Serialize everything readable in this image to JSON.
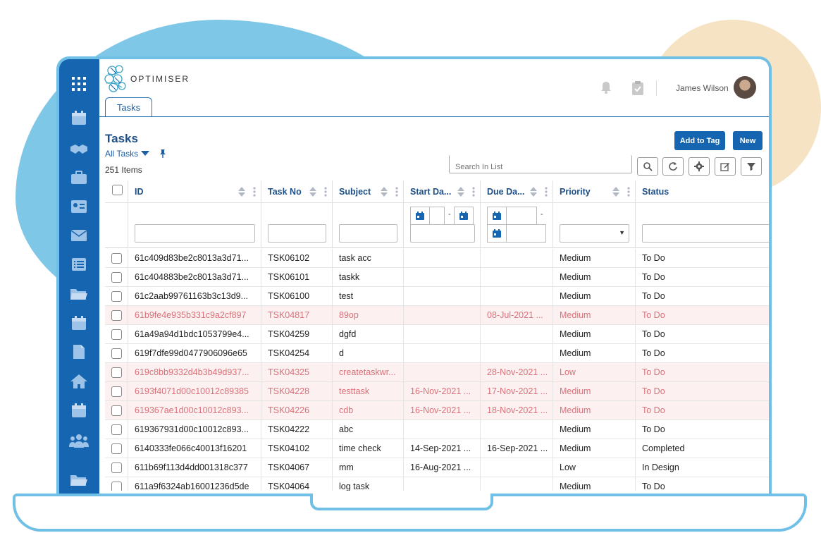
{
  "header": {
    "logo_text": "OPTIMISER",
    "user_name": "James Wilson"
  },
  "tab": {
    "label": "Tasks"
  },
  "page": {
    "title": "Tasks",
    "view_label": "All Tasks",
    "item_count": "251 Items",
    "add_to_tag_label": "Add to Tag",
    "new_label": "New",
    "search_placeholder": "Search In List"
  },
  "sidebar": {
    "icons": [
      "apps-grid-icon",
      "calendar-icon",
      "handshake-icon",
      "briefcase-icon",
      "contact-card-icon",
      "mail-icon",
      "list-icon",
      "folder-icon",
      "calendar-icon",
      "document-icon",
      "home-icon",
      "calendar-icon",
      "people-icon",
      "folder-icon"
    ]
  },
  "columns": [
    {
      "label": "ID"
    },
    {
      "label": "Task No"
    },
    {
      "label": "Subject"
    },
    {
      "label": "Start Da..."
    },
    {
      "label": "Due Da..."
    },
    {
      "label": "Priority"
    },
    {
      "label": "Status"
    }
  ],
  "rows": [
    {
      "id": "61c409d83be2c8013a3d71...",
      "task_no": "TSK06102",
      "subject": "task acc",
      "start": "",
      "due": "",
      "priority": "Medium",
      "status": "To Do",
      "highlight": false
    },
    {
      "id": "61c404883be2c8013a3d71...",
      "task_no": "TSK06101",
      "subject": "taskk",
      "start": "",
      "due": "",
      "priority": "Medium",
      "status": "To Do",
      "highlight": false
    },
    {
      "id": "61c2aab99761163b3c13d9...",
      "task_no": "TSK06100",
      "subject": "test",
      "start": "",
      "due": "",
      "priority": "Medium",
      "status": "To Do",
      "highlight": false
    },
    {
      "id": "61b9fe4e935b331c9a2cf897",
      "task_no": "TSK04817",
      "subject": "89op",
      "start": "",
      "due": "08-Jul-2021 ...",
      "priority": "Medium",
      "status": "To Do",
      "highlight": true
    },
    {
      "id": "61a49a94d1bdc1053799e4...",
      "task_no": "TSK04259",
      "subject": "dgfd",
      "start": "",
      "due": "",
      "priority": "Medium",
      "status": "To Do",
      "highlight": false
    },
    {
      "id": "619f7dfe99d0477906096e65",
      "task_no": "TSK04254",
      "subject": "d",
      "start": "",
      "due": "",
      "priority": "Medium",
      "status": "To Do",
      "highlight": false
    },
    {
      "id": "619c8bb9332d4b3b49d937...",
      "task_no": "TSK04325",
      "subject": "createtaskwr...",
      "start": "",
      "due": "28-Nov-2021 ...",
      "priority": "Low",
      "status": "To Do",
      "highlight": true
    },
    {
      "id": "6193f4071d00c10012c89385",
      "task_no": "TSK04228",
      "subject": "testtask",
      "start": "16-Nov-2021 ...",
      "due": "17-Nov-2021 ...",
      "priority": "Medium",
      "status": "To Do",
      "highlight": true
    },
    {
      "id": "619367ae1d00c10012c893...",
      "task_no": "TSK04226",
      "subject": "cdb",
      "start": "16-Nov-2021 ...",
      "due": "18-Nov-2021 ...",
      "priority": "Medium",
      "status": "To Do",
      "highlight": true
    },
    {
      "id": "619367931d00c10012c893...",
      "task_no": "TSK04222",
      "subject": "abc",
      "start": "",
      "due": "",
      "priority": "Medium",
      "status": "To Do",
      "highlight": false
    },
    {
      "id": "6140333fe066c40013f16201",
      "task_no": "TSK04102",
      "subject": "time check",
      "start": "14-Sep-2021 ...",
      "due": "16-Sep-2021 ...",
      "priority": "Medium",
      "status": "Completed",
      "highlight": false
    },
    {
      "id": "611b69f113d4dd001318c377",
      "task_no": "TSK04067",
      "subject": "mm",
      "start": "16-Aug-2021 ...",
      "due": "",
      "priority": "Low",
      "status": "In Design",
      "highlight": false
    },
    {
      "id": "611a9f6324ab16001236d5de",
      "task_no": "TSK04064",
      "subject": "log task",
      "start": "",
      "due": "",
      "priority": "Medium",
      "status": "To Do",
      "highlight": false
    }
  ],
  "colors": {
    "brand_blue": "#1565b0",
    "highlight_row_bg": "#fdf0f0",
    "highlight_row_text": "#d9727a"
  }
}
